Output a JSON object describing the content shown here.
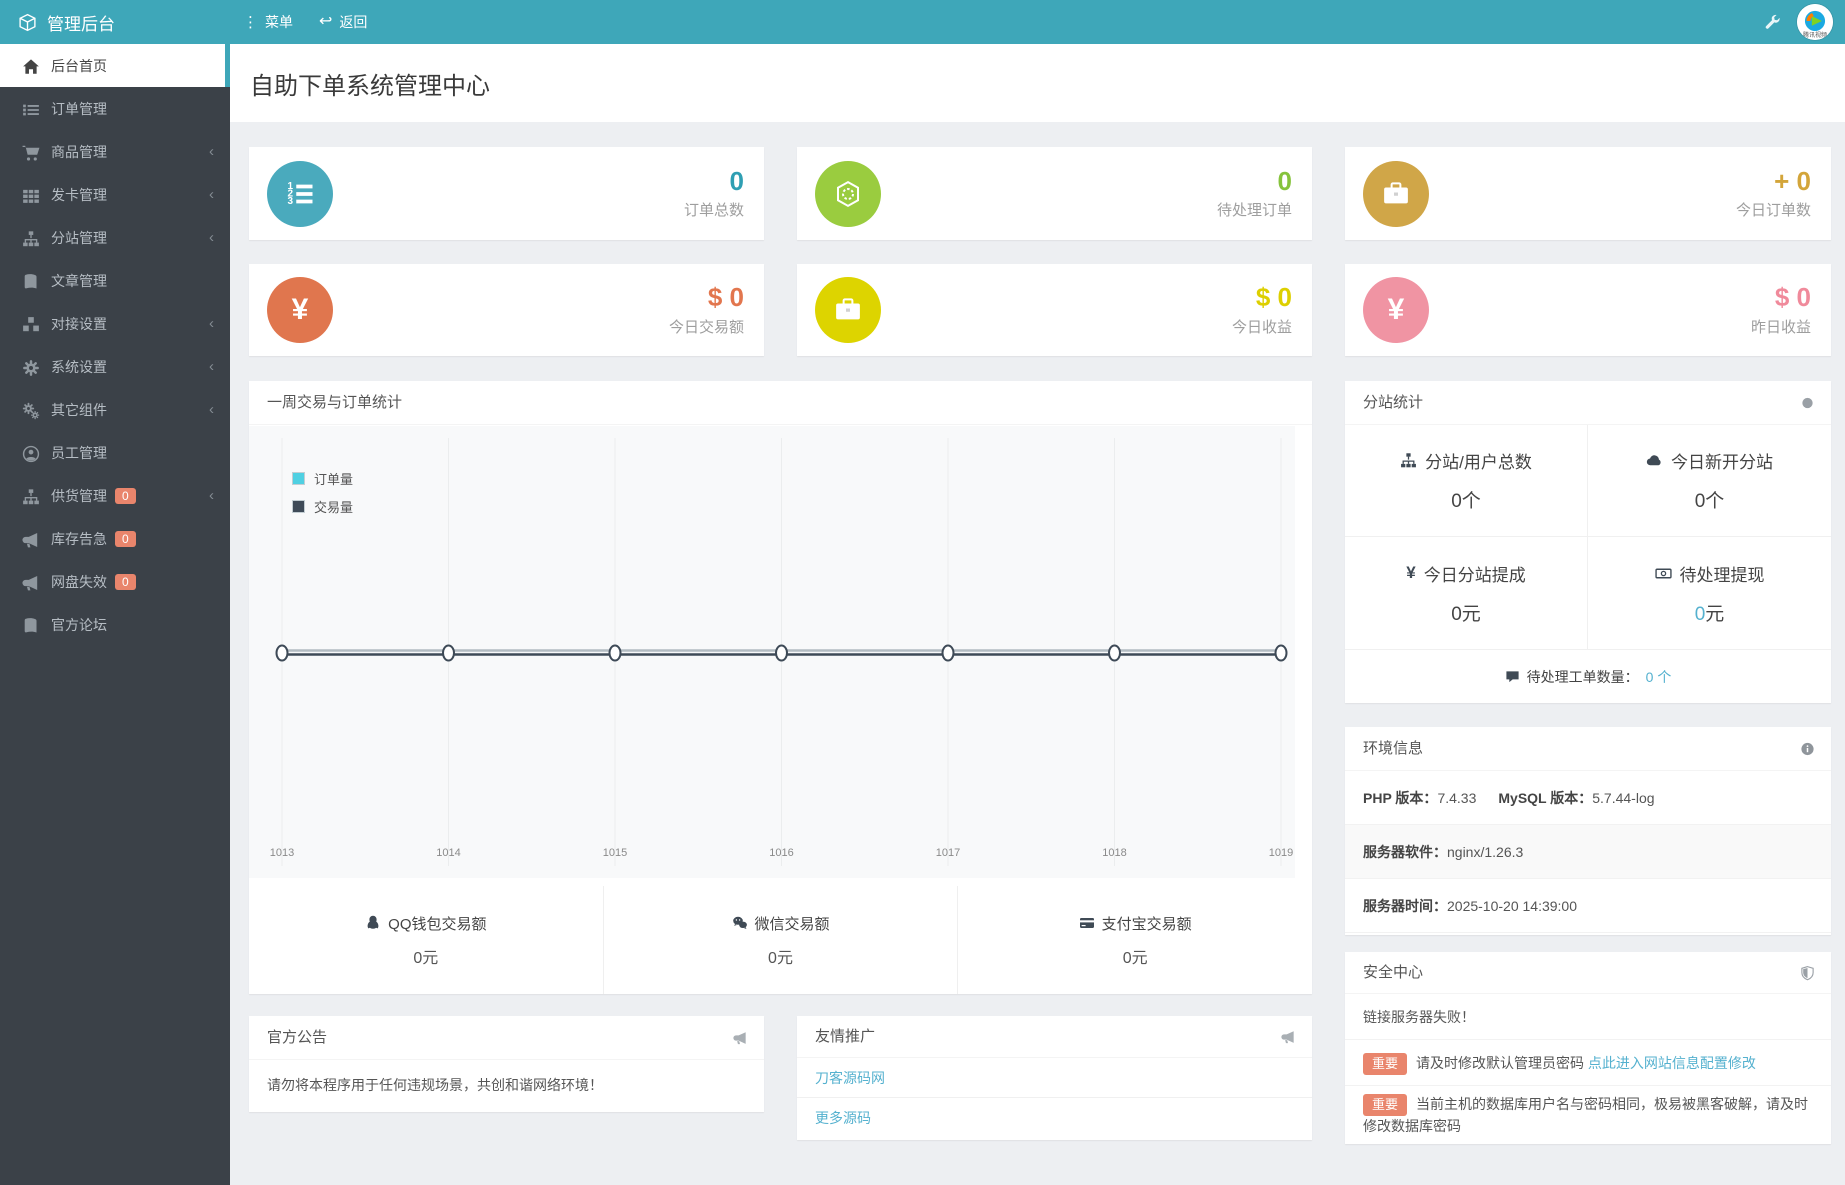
{
  "colors": {
    "navbar_teal": "#3ea7b9",
    "sidebar_dark": "#3b4148",
    "badge_orange": "#e9856c",
    "link_cyan": "#55b1cf",
    "legend_orders": "#4fd0e2",
    "legend_trades": "#3f4b58",
    "card_teal": "#4aaabd",
    "card_green": "#9acc3f",
    "card_gold": "#d0a648",
    "card_orange": "#e0764e",
    "card_yellow": "#ddd400",
    "card_pink": "#f094a3"
  },
  "navbar": {
    "brand": "管理后台",
    "menu_label": "菜单",
    "back_label": "返回",
    "avatar_caption": "腾讯视频"
  },
  "sidebar": {
    "items": [
      {
        "label": "后台首页",
        "icon": "home-icon",
        "active": true
      },
      {
        "label": "订单管理",
        "icon": "list-icon"
      },
      {
        "label": "商品管理",
        "icon": "cart-icon",
        "chevron": true
      },
      {
        "label": "发卡管理",
        "icon": "grid-icon",
        "chevron": true
      },
      {
        "label": "分站管理",
        "icon": "sitemap-icon",
        "chevron": true
      },
      {
        "label": "文章管理",
        "icon": "book-icon"
      },
      {
        "label": "对接设置",
        "icon": "cubes-icon",
        "chevron": true
      },
      {
        "label": "系统设置",
        "icon": "gear-icon",
        "chevron": true
      },
      {
        "label": "其它组件",
        "icon": "gears-icon",
        "chevron": true
      },
      {
        "label": "员工管理",
        "icon": "user-circle-icon"
      },
      {
        "label": "供货管理",
        "icon": "sitemap-icon",
        "chevron": true,
        "badge": "0"
      },
      {
        "label": "库存告急",
        "icon": "megaphone-icon",
        "badge": "0"
      },
      {
        "label": "网盘失效",
        "icon": "megaphone-icon",
        "badge": "0"
      },
      {
        "label": "官方论坛",
        "icon": "book-icon"
      }
    ]
  },
  "page": {
    "title": "自助下单系统管理中心"
  },
  "cards": [
    {
      "value": "0",
      "label": "订单总数",
      "icon": "list-ol-icon"
    },
    {
      "value": "0",
      "label": "待处理订单",
      "icon": "hexagon-icon"
    },
    {
      "value": "+ 0",
      "label": "今日订单数",
      "icon": "briefcase-icon"
    },
    {
      "value": "$ 0",
      "label": "今日交易额",
      "icon": "yen-icon"
    },
    {
      "value": "$ 0",
      "label": "今日收益",
      "icon": "briefcase-icon"
    },
    {
      "value": "$ 0",
      "label": "昨日收益",
      "icon": "yen-icon"
    }
  ],
  "chart_panel": {
    "title": "一周交易与订单统计",
    "legend": [
      {
        "label": "订单量"
      },
      {
        "label": "交易量"
      }
    ]
  },
  "chart_data": {
    "type": "line",
    "title": "一周交易与订单统计",
    "categories": [
      "1013",
      "1014",
      "1015",
      "1016",
      "1017",
      "1018",
      "1019"
    ],
    "series": [
      {
        "name": "订单量",
        "values": [
          0,
          0,
          0,
          0,
          0,
          0,
          0
        ]
      },
      {
        "name": "交易量",
        "values": [
          0,
          0,
          0,
          0,
          0,
          0,
          0
        ]
      }
    ],
    "ylim": [
      0,
      1
    ],
    "grid": "vertical-only",
    "legend_position": "top-left",
    "marker": "open-circle"
  },
  "pay_stats": [
    {
      "label": "QQ钱包交易额",
      "value": "0元",
      "icon": "qq-icon"
    },
    {
      "label": "微信交易额",
      "value": "0元",
      "icon": "wechat-icon"
    },
    {
      "label": "支付宝交易额",
      "value": "0元",
      "icon": "credit-card-icon"
    }
  ],
  "announcement": {
    "title": "官方公告",
    "body": "请勿将本程序用于任何违规场景，共创和谐网络环境！"
  },
  "promotion": {
    "title": "友情推广",
    "links": [
      {
        "label": "刀客源码网"
      },
      {
        "label": "更多源码"
      }
    ]
  },
  "substation": {
    "title": "分站统计",
    "cells": [
      {
        "label": "分站/用户总数",
        "num": "0",
        "unit": "个",
        "icon": "sitemap-icon"
      },
      {
        "label": "今日新开分站",
        "num": "0",
        "unit": "个",
        "icon": "cloud-icon"
      },
      {
        "label": "今日分站提成",
        "num": "0",
        "unit": "元",
        "icon": "yen-icon"
      },
      {
        "label": "待处理提现",
        "num": "0",
        "unit": "元",
        "icon": "money-bill-icon",
        "accent": true
      }
    ],
    "footer_label": "待处理工单数量：",
    "footer_value": "0 个"
  },
  "environment": {
    "title": "环境信息",
    "rows": [
      {
        "label": "PHP 版本：",
        "value": "7.4.33",
        "label2": "MySQL 版本：",
        "value2": "5.7.44-log"
      },
      {
        "label": "服务器软件：",
        "value": "nginx/1.26.3"
      },
      {
        "label": "服务器时间：",
        "value": "2025-10-20 14:39:00"
      }
    ]
  },
  "security": {
    "title": "安全中心",
    "rows": [
      {
        "text": "链接服务器失败！"
      },
      {
        "badge": "重要",
        "text": "请及时修改默认管理员密码",
        "link": "点此进入网站信息配置修改"
      },
      {
        "badge": "重要",
        "text": "当前主机的数据库用户名与密码相同，极易被黑客破解，请及时修改数据库密码"
      }
    ]
  }
}
